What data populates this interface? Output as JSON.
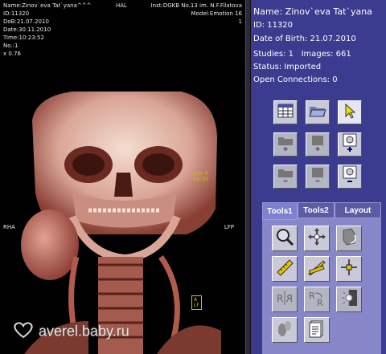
{
  "overlay": {
    "top_left": [
      "Name:Zinov`eva Tat`yana^^^",
      "ID:11320",
      "DoB:21.07.2010",
      "Date:30.11.2010",
      "Time:10:23:52",
      "No.:1",
      "x 0.76"
    ],
    "top_center": "HAL",
    "top_right": [
      "Inst:DGKB No.13 im. N.F.Filatova",
      "Model:Emotion 16",
      "1"
    ],
    "left_orient": "RHA",
    "right_orient": "LFP",
    "annotation_1": [
      "Sch: 0",
      "V4: 25"
    ],
    "annotation_2": [
      "A",
      "LF"
    ],
    "watermark": "averel.baby.ru"
  },
  "patient": {
    "name_label": "Name:",
    "name": "Zinov`eva Tat`yana",
    "id_label": "ID:",
    "id": "11320",
    "dob_label": "Date of Birth:",
    "dob": "21.07.2010",
    "studies_label": "Studies:",
    "studies": "1",
    "images_label": "Images:",
    "images": "661",
    "status_label": "Status:",
    "status": "Imported",
    "connections_label": "Open Connections:",
    "connections": "0"
  },
  "tabs": [
    {
      "label": "Tools1",
      "selected": true
    },
    {
      "label": "Tools2",
      "selected": false
    },
    {
      "label": "Layout",
      "selected": false
    }
  ],
  "colors": {
    "panel": "#3b3b8f",
    "tools_panel": "#8686c8",
    "button": "#c9c9d9",
    "overlay_text": "#e8e8e8",
    "annotation": "#d4c400"
  }
}
